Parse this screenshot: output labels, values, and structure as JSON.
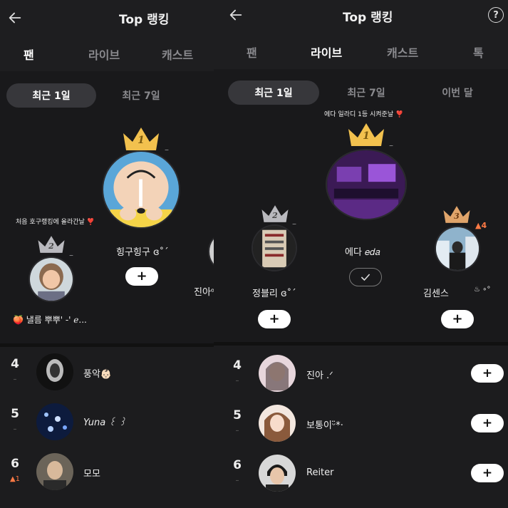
{
  "left": {
    "title": "Top 랭킹",
    "tabs": [
      "팬",
      "라이브",
      "캐스트"
    ],
    "period_tabs": [
      "최근 1일",
      "최근 7일"
    ],
    "podium": {
      "first": {
        "rank": "1",
        "name": "힝구힝구 ɞ˚ˊ",
        "delta": "–",
        "button": "+"
      },
      "second": {
        "rank": "2",
        "name": "🍑 낼름 뿌뿌' -' ℯ...",
        "delta": "–",
        "message": "처음 호구랭킹에 올라간날 ❣️"
      },
      "third_partial_name": "진아ᵒ"
    },
    "rows": [
      {
        "rank": "4",
        "delta": "–",
        "name": "풍악👶🏻"
      },
      {
        "rank": "5",
        "delta": "–",
        "name": "Yuna   ꒰ ꒱"
      },
      {
        "rank": "6",
        "delta": "▲1",
        "name": "모모"
      }
    ]
  },
  "right": {
    "title": "Top 랭킹",
    "help": "?",
    "tabs": [
      "팬",
      "라이브",
      "캐스트",
      "톡"
    ],
    "period_tabs": [
      "최근 1일",
      "최근 7일",
      "이번 달"
    ],
    "podium": {
      "first": {
        "rank": "1",
        "name": "에다 𝑒𝑑𝑎",
        "delta": "–",
        "message": "에다 일라디 1등 시켜준날 ❣️"
      },
      "second": {
        "rank": "2",
        "name": "정블리 ɞ˚ˊ",
        "delta": "–",
        "button": "+"
      },
      "third": {
        "rank": "3",
        "name": "김센스",
        "badge": "♨ ∘°",
        "delta": "▲4",
        "button": "+"
      }
    },
    "rows": [
      {
        "rank": "4",
        "delta": "–",
        "name": "진아 .ᐟ",
        "button": "+"
      },
      {
        "rank": "5",
        "delta": "–",
        "name": "보통이ᵕ̈*·",
        "button": "+"
      },
      {
        "rank": "6",
        "delta": "–",
        "name": "Reiter",
        "button": "+"
      }
    ]
  },
  "colors": {
    "background": "#1e1e20",
    "gold_crown": "#f2c14e",
    "silver_crown": "#b9b9be",
    "bronze_crown": "#e0a46a",
    "rank_up": "#ff7a45"
  }
}
